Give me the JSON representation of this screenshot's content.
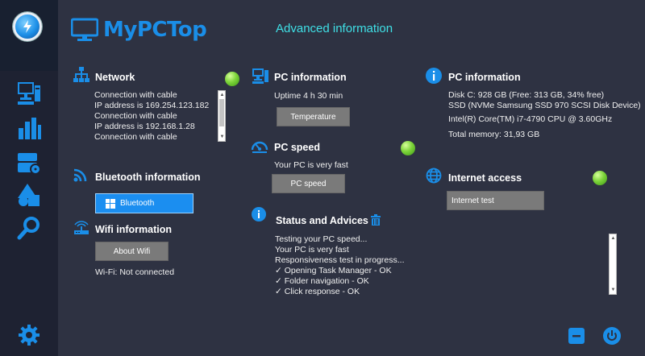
{
  "brand": {
    "name": "MyPCTop"
  },
  "header": {
    "title": "Advanced information"
  },
  "network": {
    "title": "Network",
    "lines": [
      "Connection with cable",
      "IP address is 169.254.123.182",
      "Connection with cable",
      "IP address is 192.168.1.28",
      "Connection with cable"
    ]
  },
  "bluetooth": {
    "title": "Bluetooth information",
    "button": "Bluetooth"
  },
  "wifi": {
    "title": "Wifi information",
    "button": "About Wifi",
    "status": "Wi-Fi: Not connected"
  },
  "pc_info_mid": {
    "title": "PC information",
    "uptime": "Uptime 4 h 30 min",
    "button": "Temperature"
  },
  "pc_speed": {
    "title": "PC speed",
    "status": "Your PC is very fast",
    "button": "PC speed"
  },
  "status": {
    "title": "Status and Advices",
    "lines": [
      "Testing your PC speed...",
      "Your PC is very fast",
      "Responsiveness test in progress...",
      "✓ Opening Task Manager - OK",
      "✓ Folder navigation - OK",
      "✓ Click response - OK"
    ]
  },
  "pc_info_right": {
    "title": "PC information",
    "disk": "Disk C: 928 GB (Free: 313 GB, 34% free)",
    "ssd": "SSD (NVMe Samsung SSD 970 SCSI Disk Device)",
    "cpu": "Intel(R) Core(TM) i7-4790 CPU @ 3.60GHz",
    "memory": "Total memory: 31,93 GB"
  },
  "internet": {
    "title": "Internet access",
    "button": "Internet test"
  },
  "colors": {
    "accent": "#1a8ee8",
    "title_cyan": "#3fe0e6",
    "ok_green": "#7dd43a",
    "sidebar": "#1e2232"
  }
}
